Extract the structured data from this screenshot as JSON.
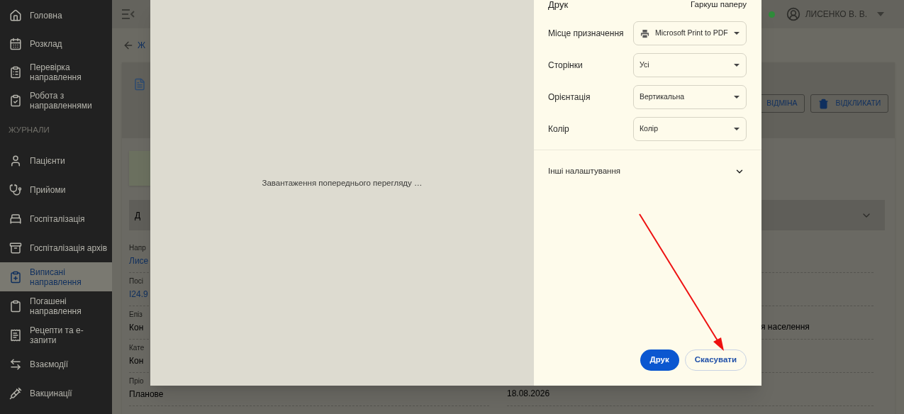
{
  "sidebar": {
    "top_items": [
      {
        "label": "Головна",
        "selected": false
      },
      {
        "label": "Розклад",
        "selected": false
      },
      {
        "label": "Перевірка направлення",
        "selected": false
      },
      {
        "label": "Робота з направленнями",
        "selected": false
      }
    ],
    "section_title": "ЖУРНАЛИ",
    "journal_items": [
      {
        "label": "Пацієнти",
        "selected": false
      },
      {
        "label": "Прийоми",
        "selected": false
      },
      {
        "label": "Госпіталізація",
        "selected": false
      },
      {
        "label": "Госпіталізація архів",
        "selected": false
      },
      {
        "label": "Виписані направлення",
        "selected": true
      },
      {
        "label": "Погашені направлення",
        "selected": false
      },
      {
        "label": "Рецепти та е-запити",
        "selected": false
      },
      {
        "label": "Взаємодії",
        "selected": false
      },
      {
        "label": "Вакцинації",
        "selected": false
      }
    ]
  },
  "topbar": {
    "user": "ЛИСЕНКО В. В.",
    "online": true
  },
  "back_link": "Ж",
  "card": {
    "buttons": [
      "ВІДМІНА",
      "ВІДКЛИКАТИ"
    ],
    "section_title": "Д",
    "fields": [
      {
        "label": "Напр",
        "value": "Лисе",
        "link": true
      },
      {
        "label": "Посі",
        "value": "I24.9",
        "link": true
      },
      {
        "label": "Епіз",
        "value": "Кон",
        "link": false,
        "right_value": "я населення"
      },
      {
        "label": "Кате",
        "value": "Кон",
        "link": false
      },
      {
        "label": "Пріо",
        "value": "Планове",
        "link": false,
        "right_value": "18.08.2026"
      }
    ]
  },
  "print_dialog": {
    "preview_text": "Завантаження попереднього перегляду …",
    "title": "Друк",
    "sheets": "Гаркуш паперу",
    "settings": [
      {
        "label": "Місце призначення",
        "value": "Microsoft Print to PDF",
        "kind": "printer"
      },
      {
        "label": "Сторінки",
        "value": "Усі",
        "kind": "select"
      },
      {
        "label": "Орієнтація",
        "value": "Вертикальна",
        "kind": "select"
      },
      {
        "label": "Колір",
        "value": "Колір",
        "kind": "select"
      }
    ],
    "more_settings": {
      "label": "Інші налаштування",
      "expanded": false
    },
    "buttons": [
      {
        "label": "Друк",
        "primary": true
      },
      {
        "label": "Скасувати",
        "primary": false
      }
    ]
  }
}
